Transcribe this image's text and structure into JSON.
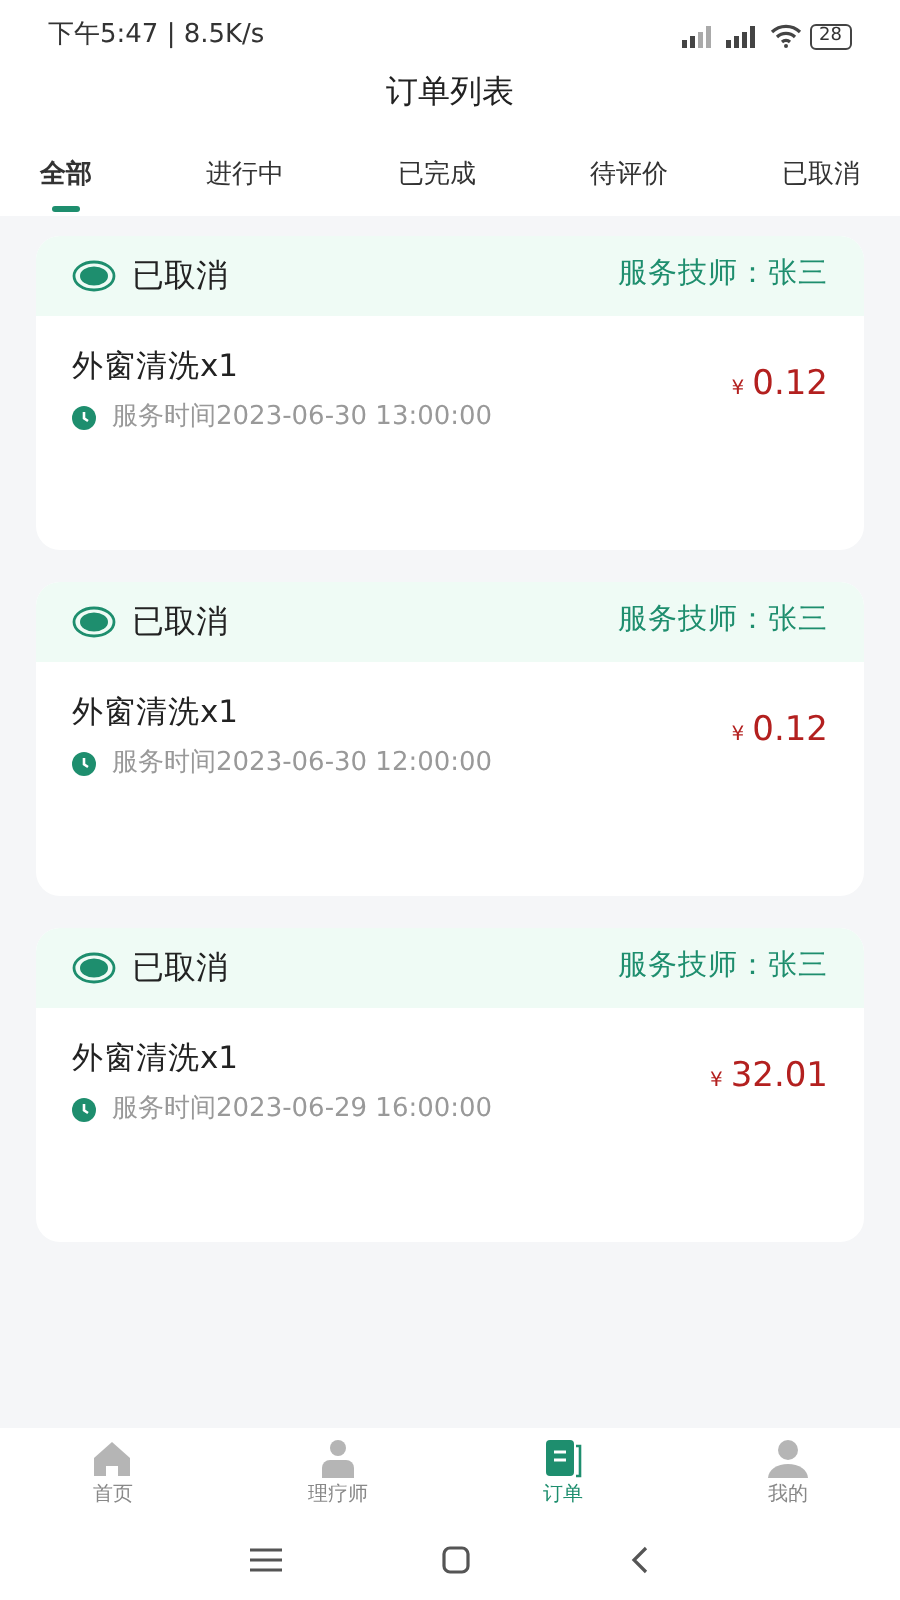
{
  "status_bar": {
    "time": "下午5:47 | 8.5K/s",
    "battery": "28"
  },
  "title": "订单列表",
  "tabs": [
    {
      "label": "全部",
      "selected": true
    },
    {
      "label": "进行中",
      "selected": false
    },
    {
      "label": "已完成",
      "selected": false
    },
    {
      "label": "待评价",
      "selected": false
    },
    {
      "label": "已取消",
      "selected": false
    }
  ],
  "orders": [
    {
      "status": "已取消",
      "technician": "服务技师：张三",
      "service": "外窗清洗x1",
      "time": "服务时间2023-06-30 13:00:00",
      "currency": "¥",
      "price": "0.12"
    },
    {
      "status": "已取消",
      "technician": "服务技师：张三",
      "service": "外窗清洗x1",
      "time": "服务时间2023-06-30 12:00:00",
      "currency": "¥",
      "price": "0.12"
    },
    {
      "status": "已取消",
      "technician": "服务技师：张三",
      "service": "外窗清洗x1",
      "time": "服务时间2023-06-29 16:00:00",
      "currency": "¥",
      "price": "32.01"
    }
  ],
  "bottom_nav": [
    {
      "kind": "home",
      "label": "首页",
      "selected": false
    },
    {
      "kind": "therapist",
      "label": "理疗师",
      "selected": false
    },
    {
      "kind": "orders",
      "label": "订单",
      "selected": true
    },
    {
      "kind": "profile",
      "label": "我的",
      "selected": false
    }
  ]
}
